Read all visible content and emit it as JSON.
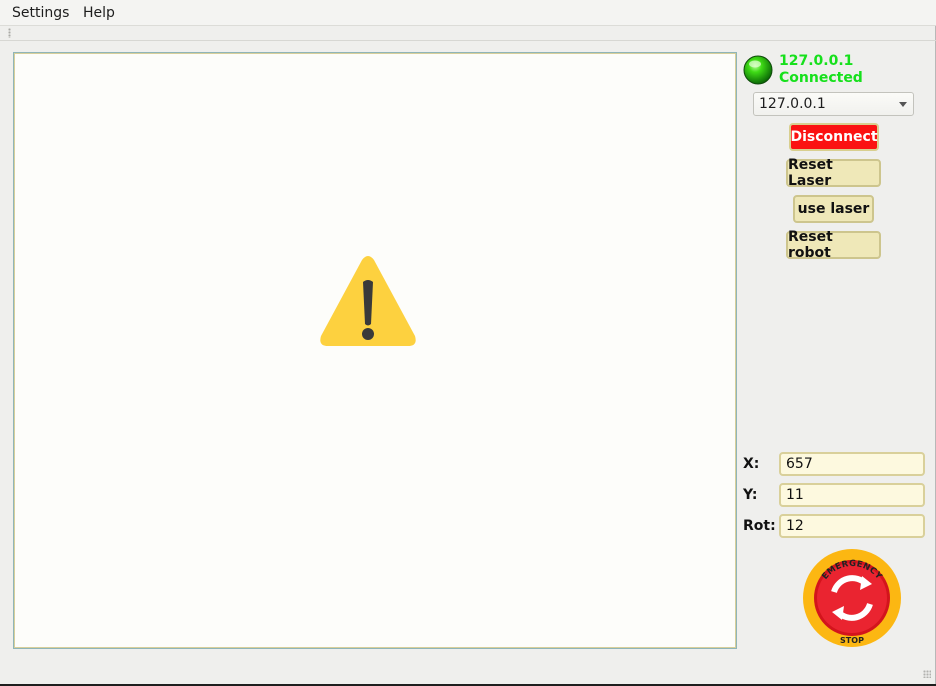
{
  "menubar": {
    "items": [
      {
        "label": "Settings"
      },
      {
        "label": "Help"
      }
    ]
  },
  "connection": {
    "status_color": "#16e01c",
    "address": "127.0.0.1",
    "status_text": "Connected",
    "selected_address": "127.0.0.1"
  },
  "buttons": {
    "disconnect": "Disconnect",
    "reset_laser": "Reset Laser",
    "use_laser": "use laser",
    "reset_robot": "Reset robot"
  },
  "coordinates": {
    "x_label": "X:",
    "x_value": "657",
    "y_label": "Y:",
    "y_value": "11",
    "rot_label": "Rot:",
    "rot_value": "12"
  },
  "viewport": {
    "icon": "warning-icon"
  },
  "emergency_stop": {
    "top_text": "EMERGENCY",
    "bottom_text": "STOP",
    "icon": "emergency-stop-icon"
  }
}
